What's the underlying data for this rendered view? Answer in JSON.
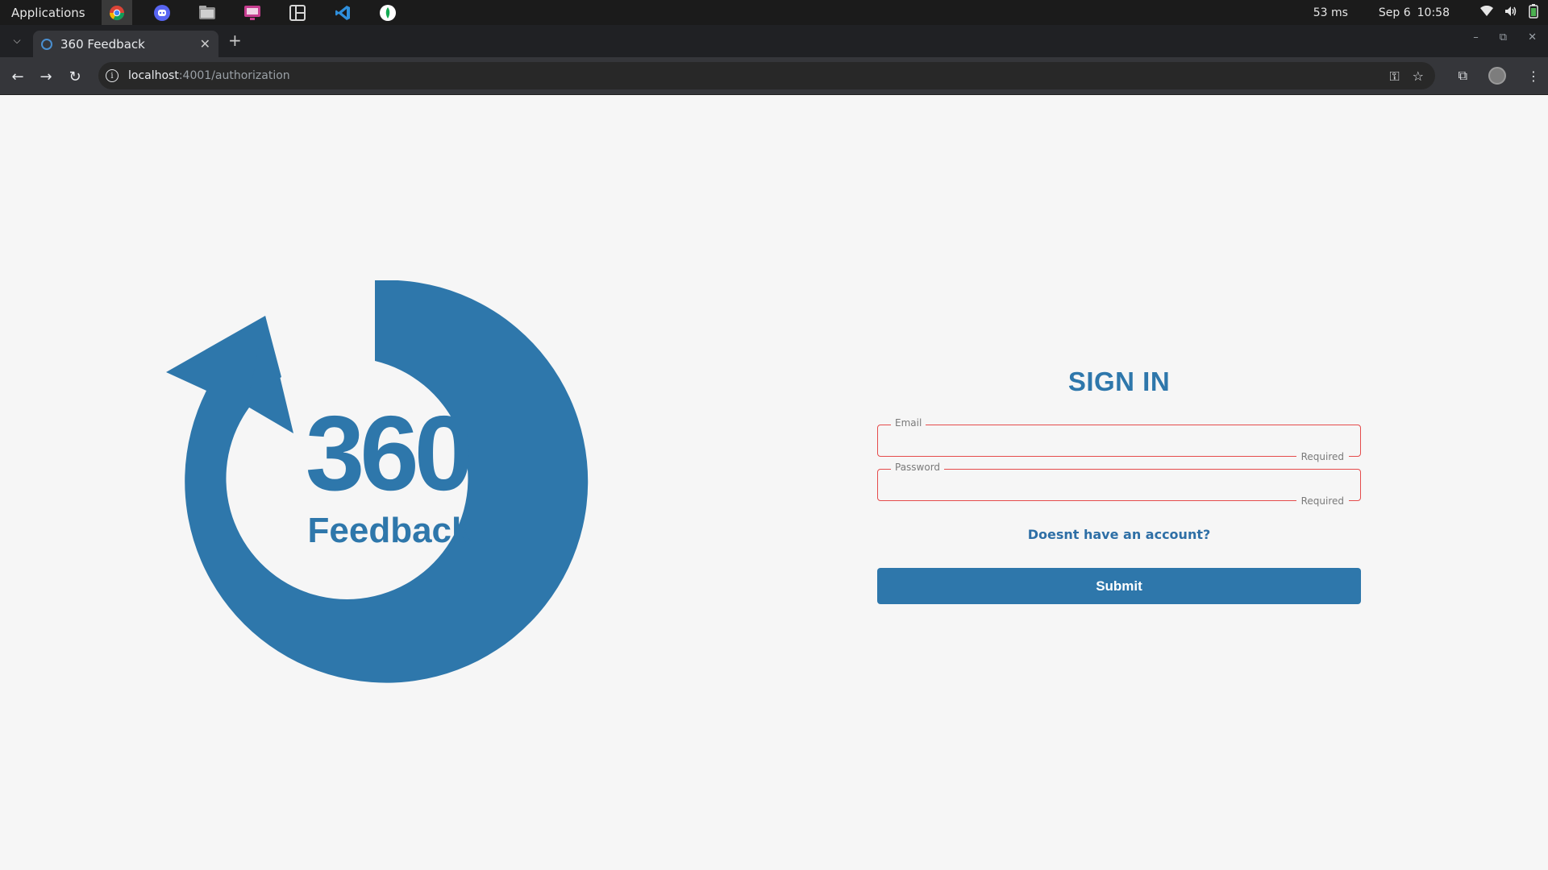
{
  "os_bar": {
    "applications_label": "Applications",
    "latency": "53 ms",
    "date": "Sep 6",
    "time": "10:58",
    "icons": [
      "chrome-icon",
      "discord-icon",
      "files-icon",
      "screenshot-icon",
      "layout-icon",
      "vscode-icon",
      "mongodb-icon"
    ]
  },
  "browser": {
    "tab_title": "360 Feedback",
    "url_host": "localhost",
    "url_path": ":4001/authorization"
  },
  "logo": {
    "number": "360",
    "word": "Feedback",
    "color": "#2e77ab"
  },
  "signin": {
    "title": "SIGN IN",
    "email_label": "Email",
    "email_value": "",
    "email_helper": "Required",
    "password_label": "Password",
    "password_value": "",
    "password_helper": "Required",
    "signup_link": "Doesnt have an account?",
    "submit_label": "Submit"
  },
  "colors": {
    "accent": "#2e77ab",
    "error": "#e54b4b",
    "background": "#f6f6f6"
  }
}
